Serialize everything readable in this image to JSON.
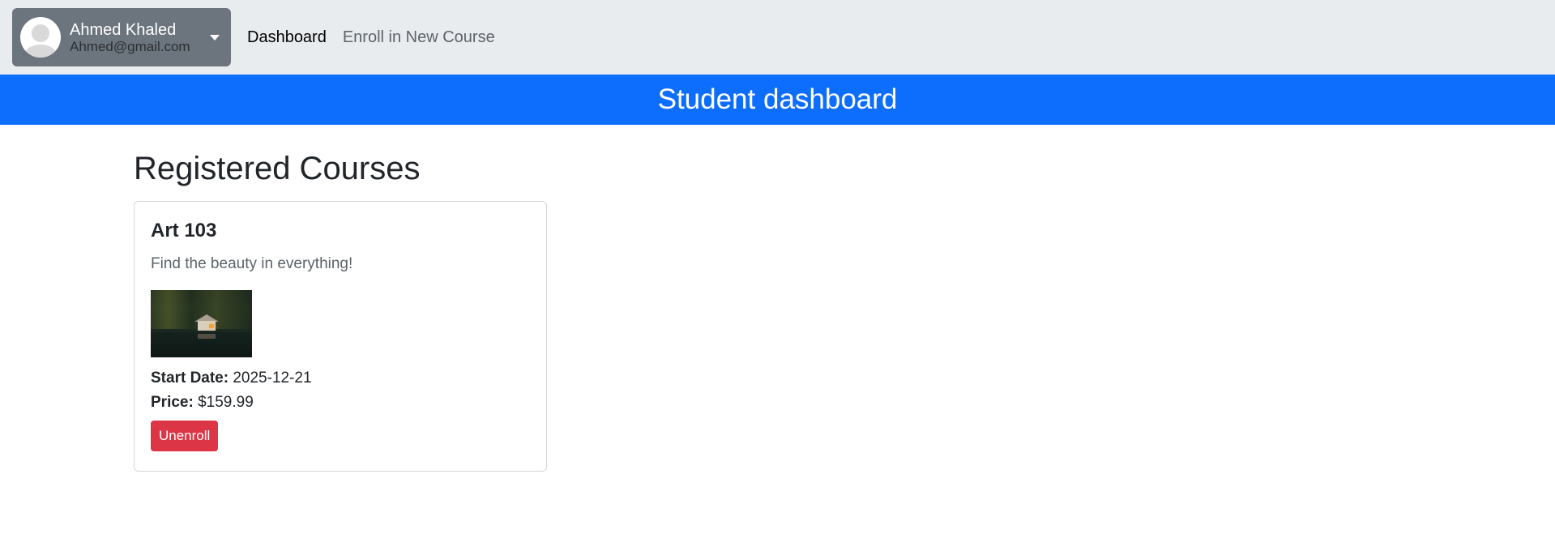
{
  "navbar": {
    "user": {
      "name": "Ahmed Khaled",
      "email": "Ahmed@gmail.com",
      "avatar_icon": "user-avatar-icon",
      "dropdown_icon": "caret-down-icon"
    },
    "links": [
      {
        "label": "Dashboard",
        "active": true
      },
      {
        "label": "Enroll in New Course",
        "active": false
      }
    ]
  },
  "hero": {
    "title": "Student dashboard",
    "color": "#0d6efd"
  },
  "main": {
    "section_title": "Registered Courses",
    "courses": [
      {
        "title": "Art 103",
        "subtitle": "Find the beauty in everything!",
        "start_date_label": "Start Date:",
        "start_date": "2025-12-21",
        "price_label": "Price:",
        "price": "$159.99",
        "unenroll_label": "Unenroll",
        "unenroll_color": "#dc3545"
      }
    ]
  }
}
